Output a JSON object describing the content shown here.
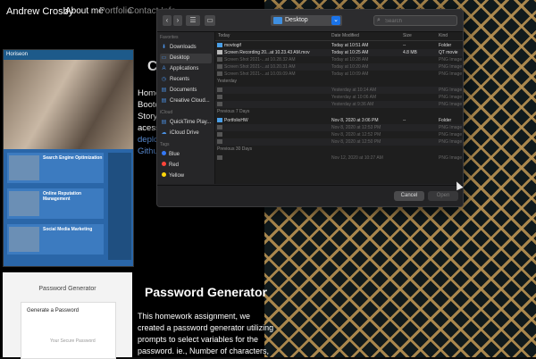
{
  "navbar": {
    "brand": "Andrew Crosby",
    "links": [
      {
        "label": "About me"
      },
      {
        "label": "Portfolio"
      },
      {
        "label": "Contact Info"
      }
    ]
  },
  "projects": [
    {
      "title": "C",
      "thumb_nav": "Horiseon",
      "thumb_sections": [
        "Search Engine Optimization",
        "Online Reputation Management",
        "Social Media Marketing"
      ],
      "text_lines": [
        "Home",
        "Bootc",
        "Story,",
        "acess"
      ],
      "links": [
        "deplo",
        "Githu"
      ]
    },
    {
      "title": "Password Generator",
      "thumb_heading": "Password Generator",
      "thumb_box_title": "Generate a Password",
      "thumb_box_placeholder": "Your Secure Password",
      "text_lines": [
        "This homework assignment, we",
        "created a password generator utilizing",
        "prompts to select variables for the",
        "password. ie., Number of characters,"
      ]
    }
  ],
  "dialog": {
    "location": "Desktop",
    "search_placeholder": "Search",
    "sidebar": {
      "favorites_label": "Favorites",
      "favorites": [
        {
          "label": "Downloads",
          "icon": "download-icon"
        },
        {
          "label": "Desktop",
          "icon": "desktop-icon",
          "selected": true
        },
        {
          "label": "Applications",
          "icon": "applications-icon"
        },
        {
          "label": "Recents",
          "icon": "clock-icon"
        },
        {
          "label": "Documents",
          "icon": "document-icon"
        },
        {
          "label": "Creative Cloud...",
          "icon": "creative-cloud-icon"
        }
      ],
      "icloud_label": "iCloud",
      "icloud": [
        {
          "label": "QuickTime Play...",
          "icon": "quicktime-icon"
        },
        {
          "label": "iCloud Drive",
          "icon": "cloud-icon"
        }
      ],
      "tags_label": "Tags",
      "tags": [
        {
          "label": "Blue",
          "color": "#3478f6"
        },
        {
          "label": "Red",
          "color": "#ff453a"
        },
        {
          "label": "Yellow",
          "color": "#ffd60a"
        }
      ]
    },
    "columns": {
      "name": "Today",
      "date": "Date Modified",
      "size": "Size",
      "kind": "Kind"
    },
    "sections": [
      {
        "label": "",
        "rows": [
          {
            "name": "movtogif",
            "date": "Today at 10:51 AM",
            "size": "--",
            "kind": "Folder",
            "enabled": true,
            "type": "folder"
          },
          {
            "name": "Screen Recording 20...at 10.23.43 AM.mov",
            "date": "Today at 10:25 AM",
            "size": "4.8 MB",
            "kind": "QT movie",
            "enabled": true,
            "type": "file"
          },
          {
            "name": "Screen Shot 2021-...at 10.28.32 AM",
            "date": "Today at 10:28 AM",
            "size": "",
            "kind": "PNG Image",
            "enabled": false,
            "type": "file"
          },
          {
            "name": "Screen Shot 2021-...at 10.20.31 AM",
            "date": "Today at 10:20 AM",
            "size": "",
            "kind": "PNG Image",
            "enabled": false,
            "type": "file"
          },
          {
            "name": "Screen Shot 2021-...at 10.09.09 AM",
            "date": "Today at 10:09 AM",
            "size": "",
            "kind": "PNG Image",
            "enabled": false,
            "type": "file"
          }
        ]
      },
      {
        "label": "Yesterday",
        "rows": [
          {
            "name": "",
            "date": "Yesterday at 10:14 AM",
            "size": "",
            "kind": "PNG Image",
            "enabled": false,
            "type": "file"
          },
          {
            "name": "",
            "date": "Yesterday at 10:06 AM",
            "size": "",
            "kind": "PNG Image",
            "enabled": false,
            "type": "file"
          },
          {
            "name": "",
            "date": "Yesterday at 9:36 AM",
            "size": "",
            "kind": "PNG Image",
            "enabled": false,
            "type": "file"
          }
        ]
      },
      {
        "label": "Previous 7 Days",
        "rows": [
          {
            "name": "PortfolioHW",
            "date": "Nov 8, 2020 at 3:06 PM",
            "size": "--",
            "kind": "Folder",
            "enabled": true,
            "type": "folder"
          },
          {
            "name": "",
            "date": "Nov 8, 2020 at 12:53 PM",
            "size": "",
            "kind": "PNG Image",
            "enabled": false,
            "type": "file"
          },
          {
            "name": "",
            "date": "Nov 8, 2020 at 12:52 PM",
            "size": "",
            "kind": "PNG Image",
            "enabled": false,
            "type": "file"
          },
          {
            "name": "",
            "date": "Nov 8, 2020 at 12:50 PM",
            "size": "",
            "kind": "PNG Image",
            "enabled": false,
            "type": "file"
          }
        ]
      },
      {
        "label": "Previous 30 Days",
        "rows": [
          {
            "name": "",
            "date": "Nov 12, 2020 at 10:27 AM",
            "size": "",
            "kind": "PNG Image",
            "enabled": false,
            "type": "file"
          }
        ]
      }
    ],
    "buttons": {
      "cancel": "Cancel",
      "open": "Open"
    }
  }
}
